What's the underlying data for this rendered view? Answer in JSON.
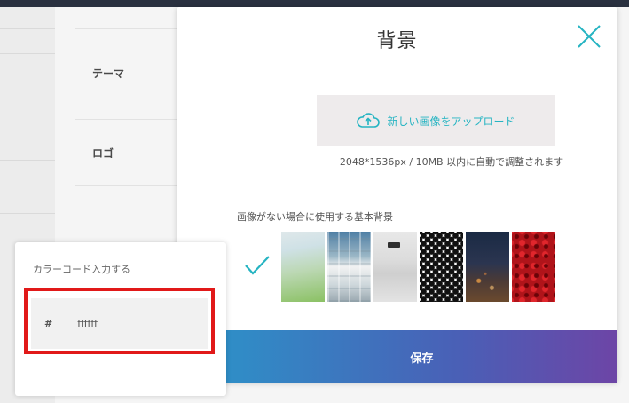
{
  "settings_page": {
    "rows": [
      {
        "label": "テーマ"
      },
      {
        "label": "ロゴ"
      }
    ]
  },
  "modal": {
    "title": "背景",
    "upload_label": "新しい画像をアップロード",
    "upload_hint": "2048*1536px / 10MB 以内に自動で調整されます",
    "basic_label": "画像がない場合に使用する基本背景",
    "save_label": "保存",
    "accent_color": "#25b4c2"
  },
  "color_popup": {
    "title": "カラーコード入力する",
    "prefix": "#",
    "value": "ffffff"
  },
  "icons": {
    "close": "close-icon",
    "upload": "cloud-upload-icon",
    "check": "check-icon"
  },
  "colors": {
    "highlight": "#e11919",
    "save_gradient_start": "#2f8ec7",
    "save_gradient_end": "#6d45a6"
  }
}
